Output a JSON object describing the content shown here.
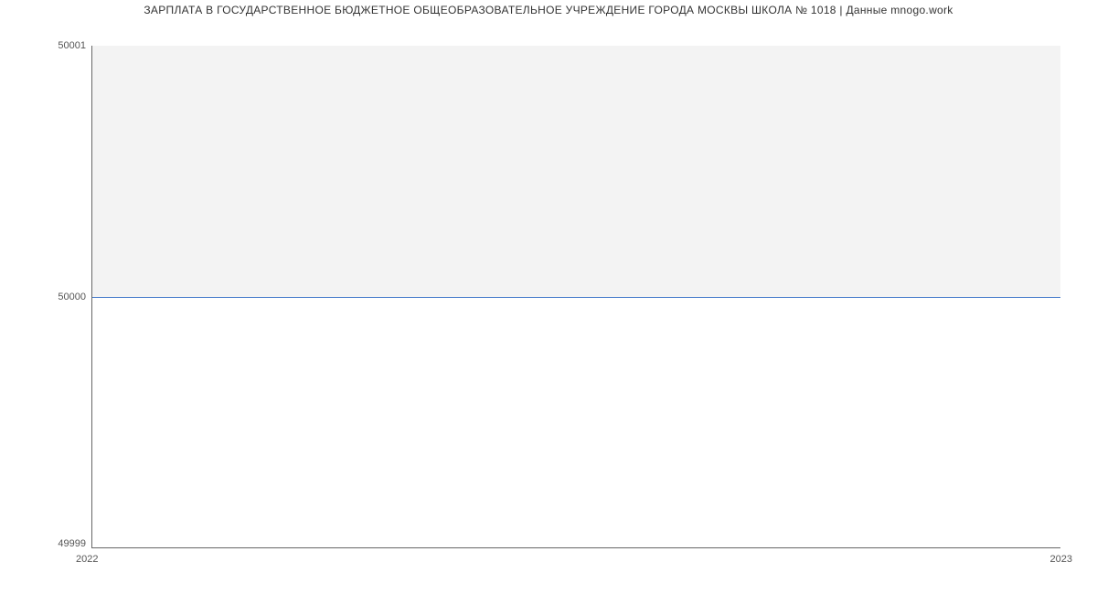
{
  "chart_data": {
    "type": "line",
    "title": "ЗАРПЛАТА В ГОСУДАРСТВЕННОЕ БЮДЖЕТНОЕ ОБЩЕОБРАЗОВАТЕЛЬНОЕ УЧРЕЖДЕНИЕ ГОРОДА МОСКВЫ  ШКОЛА № 1018 | Данные mnogo.work",
    "xlabel": "",
    "ylabel": "",
    "x": [
      2022,
      2023
    ],
    "x_ticks": [
      "2022",
      "2023"
    ],
    "y_ticks": [
      "49999",
      "50000",
      "50001"
    ],
    "ylim": [
      49999,
      50001
    ],
    "series": [
      {
        "name": "salary",
        "values": [
          50000,
          50000
        ],
        "color": "#4a7ecc"
      }
    ],
    "fill_above_line": true,
    "fill_color": "#f3f3f3"
  }
}
